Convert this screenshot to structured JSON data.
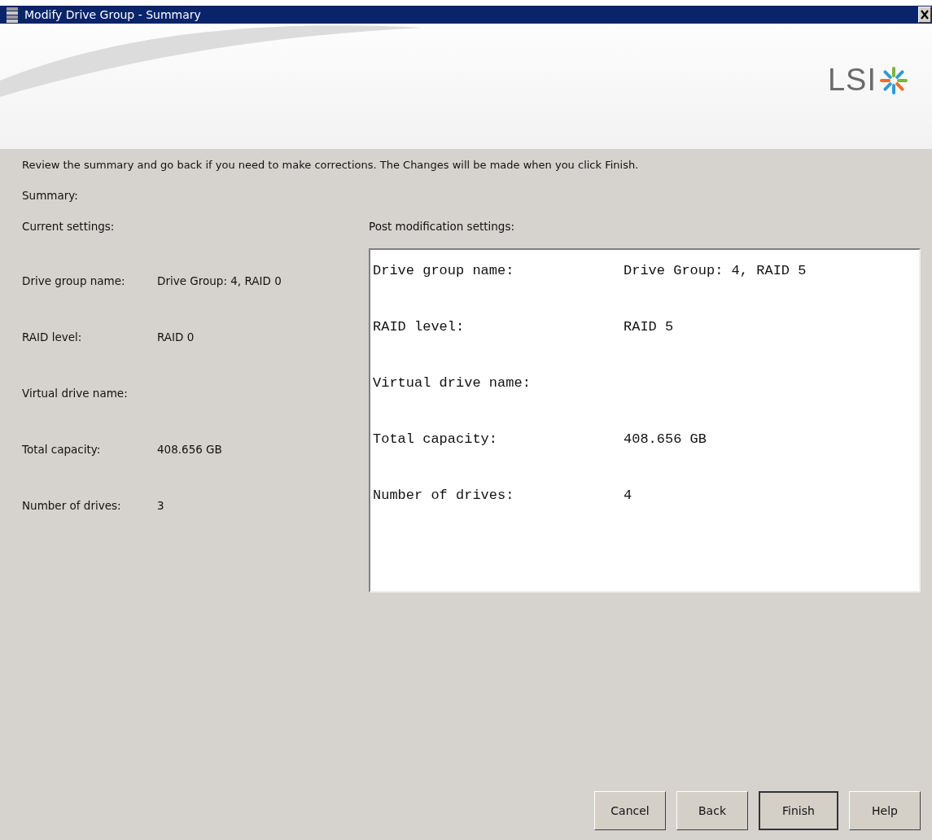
{
  "window": {
    "title": "Modify Drive Group - Summary"
  },
  "header": {
    "logo_text": "LSI"
  },
  "instructions": "Review the summary and go back if you need to make corrections. The Changes will be made when you click Finish.",
  "summary_label": "Summary:",
  "current_settings": {
    "heading": "Current settings:",
    "rows": [
      {
        "label": "Drive group name:",
        "value": "Drive Group: 4, RAID 0"
      },
      {
        "label": "RAID level:",
        "value": "RAID 0"
      },
      {
        "label": "Virtual drive name:"
      },
      {
        "label": "Total capacity:",
        "value": "408.656 GB"
      },
      {
        "label": "Number of drives:",
        "value": "3"
      }
    ]
  },
  "post_settings": {
    "heading": "Post modification settings:",
    "rows": [
      {
        "label": "Drive group name:",
        "value": "Drive Group: 4, RAID 5"
      },
      {
        "label": "RAID level:",
        "value": "RAID 5"
      },
      {
        "label": "Virtual drive name:"
      },
      {
        "label": "Total capacity:",
        "value": "408.656 GB"
      },
      {
        "label": "Number of drives:",
        "value": "4"
      }
    ]
  },
  "buttons": [
    {
      "label": "Cancel",
      "default": false
    },
    {
      "label": "Back",
      "default": false
    },
    {
      "label": "Finish",
      "default": true
    },
    {
      "label": "Help",
      "default": false
    }
  ]
}
